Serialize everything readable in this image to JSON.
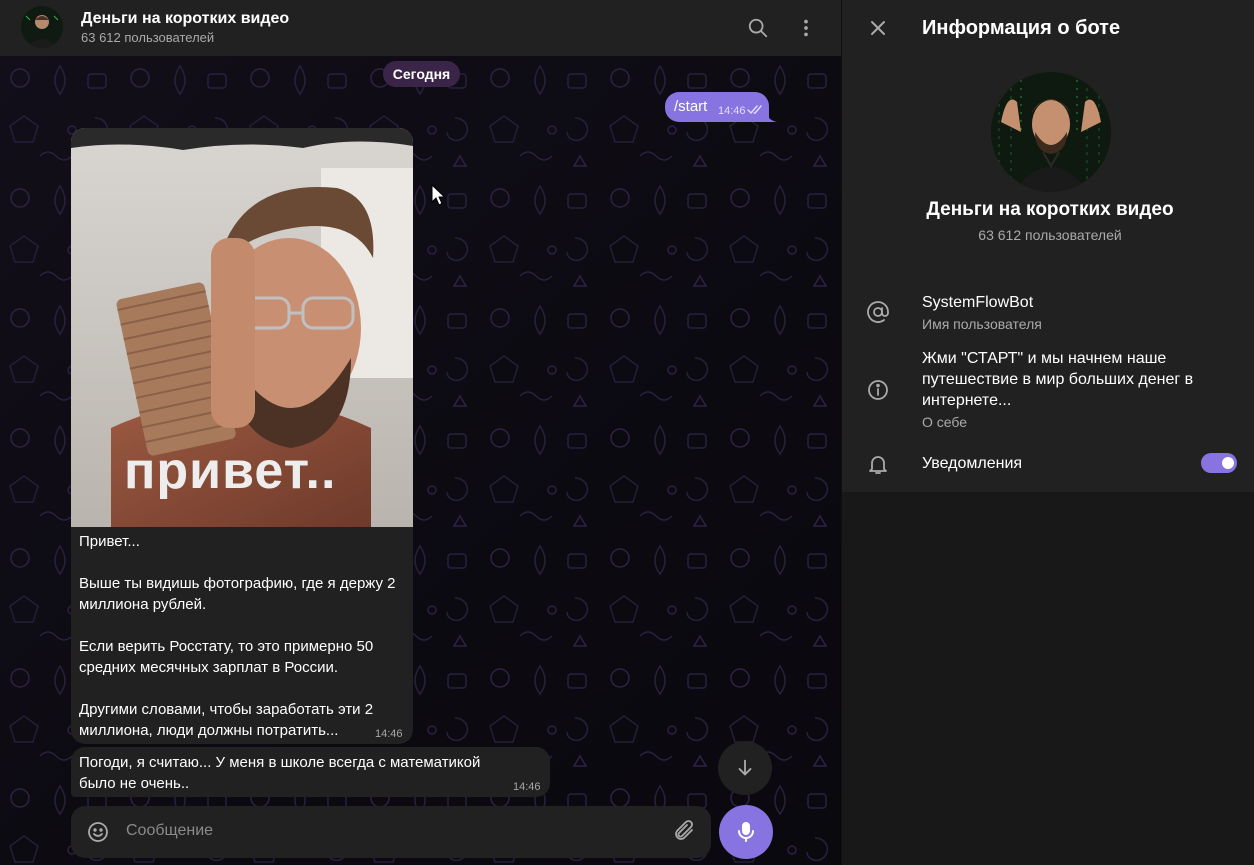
{
  "chat": {
    "title": "Деньги на коротких видео",
    "subscribers": "63 612 пользователей",
    "date_separator": "Сегодня",
    "outgoing": {
      "text": "/start",
      "time": "14:46"
    },
    "photo_message": {
      "photo_text": "привет..",
      "text": "Привет...\n\nВыше ты видишь фотографию, где я держу 2 миллиона рублей.\n\nЕсли верить Росстату, то это примерно 50 средних месячных зарплат в России.\n\nДругими словами, чтобы заработать эти 2 миллиона, люди должны потратить...",
      "time": "14:46"
    },
    "text_message": {
      "text": "Погоди, я считаю... У меня в школе всегда с математикой было не очень..",
      "time": "14:46"
    },
    "composer": {
      "placeholder": "Сообщение"
    }
  },
  "icons": {
    "search": "search-icon",
    "menu": "more-vertical-icon",
    "emoji": "smile-icon",
    "attach": "paperclip-icon",
    "mic": "microphone-icon",
    "scroll": "arrow-down-icon",
    "close": "close-icon",
    "username": "at-icon",
    "about": "info-icon",
    "notifications": "bell-icon"
  },
  "panel": {
    "title": "Информация о боте",
    "name": "Деньги на коротких видео",
    "subscribers": "63 612 пользователей",
    "username": "SystemFlowBot",
    "username_label": "Имя пользователя",
    "bio": "Жми \"СТАРТ\" и мы начнем наше путешествие в мир больших денег в интернете...",
    "bio_label": "О себе",
    "notifications_label": "Уведомления",
    "notifications_on": true
  },
  "colors": {
    "accent": "#8774e1",
    "panel_bg": "#212121",
    "chat_bg": "#0d0b12",
    "date_pill": "#3a2549"
  }
}
